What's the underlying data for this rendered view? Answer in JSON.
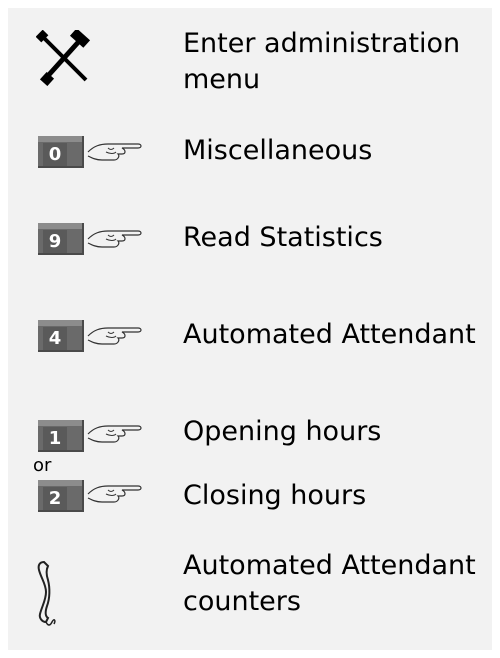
{
  "steps": [
    {
      "text": "Enter administration\nmenu",
      "icon": "tools-icon"
    },
    {
      "key": "0",
      "text": "Miscellaneous",
      "icon": "pointing-hand-icon"
    },
    {
      "key": "9",
      "text": "Read Statistics",
      "icon": "pointing-hand-icon"
    },
    {
      "key": "4",
      "text": "Automated Attendant",
      "icon": "pointing-hand-icon"
    },
    {
      "key": "1",
      "text": "Opening hours",
      "icon": "pointing-hand-icon"
    },
    {
      "or": "or"
    },
    {
      "key": "2",
      "text": "Closing hours",
      "icon": "pointing-hand-icon"
    },
    {
      "text": "Automated Attendant\ncounters",
      "icon": "handset-icon"
    }
  ]
}
